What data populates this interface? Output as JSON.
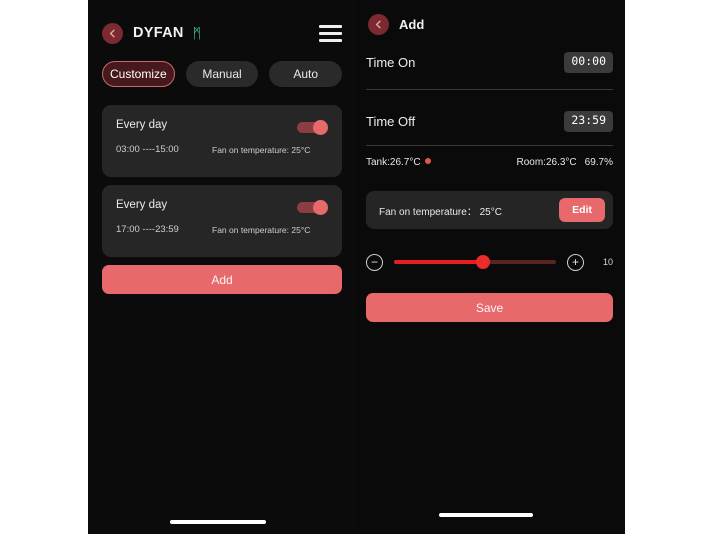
{
  "left": {
    "back_icon": "chevron-left-icon",
    "title": "DYFAN",
    "bluetooth_icon": "bluetooth-icon",
    "bluetooth_glyph": "ᛗ",
    "menu_icon": "hamburger-menu-icon",
    "tabs": [
      {
        "label": "Customize",
        "active": true
      },
      {
        "label": "Manual",
        "active": false
      },
      {
        "label": "Auto",
        "active": false
      }
    ],
    "schedules": [
      {
        "title": "Every day",
        "time_range": "03:00 ----15:00",
        "temperature": "Fan on temperature: 25°C",
        "enabled": true
      },
      {
        "title": "Every day",
        "time_range": "17:00 ----23:59",
        "temperature": "Fan on temperature: 25°C",
        "enabled": true
      }
    ],
    "add_label": "Add"
  },
  "right": {
    "back_icon": "chevron-left-icon",
    "title": "Add",
    "time_on_label": "Time On",
    "time_on_value": "00:00",
    "time_off_label": "Time Off",
    "time_off_value": "23:59",
    "tank_reading": "Tank:26.7°C",
    "room_temperature": "Room:26.3°C",
    "room_humidity": "69.7%",
    "fan_label": "Fan on temperature： 25°C",
    "edit_label": "Edit",
    "slider": {
      "minus_label": "−",
      "plus_label": "+",
      "value": "10",
      "percent": 55
    },
    "save_label": "Save"
  },
  "colors": {
    "accent": "#e7696b",
    "slider": "#ec2b2b",
    "bluetooth": "#4fd6ae",
    "tank_dot": "#e2564e",
    "background": "#0b0b0b"
  }
}
